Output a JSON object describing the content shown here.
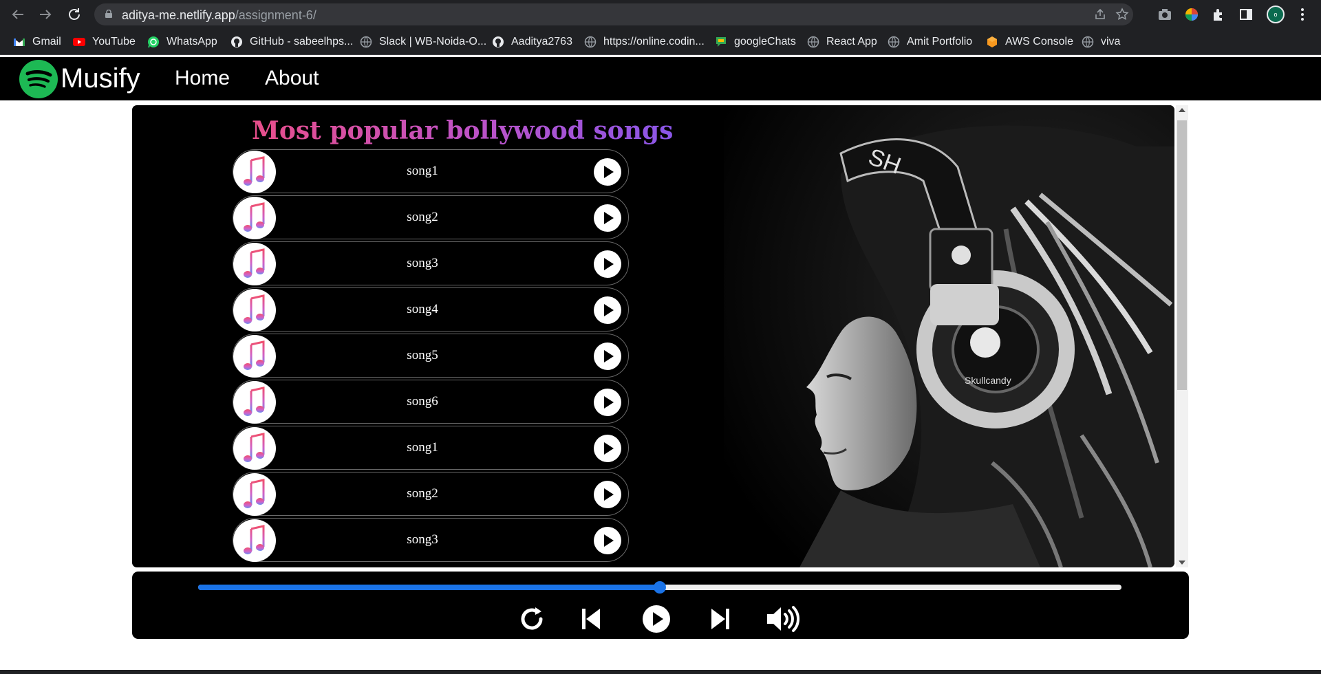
{
  "browser": {
    "url_host": "aditya-me.netlify.app",
    "url_path": "/assignment-6/",
    "profile_initial": "o",
    "bookmarks": [
      {
        "label": "Gmail",
        "icon": "gmail-icon",
        "color": "#ea4335"
      },
      {
        "label": "YouTube",
        "icon": "youtube-icon",
        "color": "#ff0000"
      },
      {
        "label": "WhatsApp",
        "icon": "whatsapp-icon",
        "color": "#25d366"
      },
      {
        "label": "GitHub - sabeelhps...",
        "icon": "github-icon",
        "color": "#e8eaed"
      },
      {
        "label": "Slack | WB-Noida-O...",
        "icon": "globe-icon",
        "color": "#9aa0a6"
      },
      {
        "label": "Aaditya2763",
        "icon": "github-icon",
        "color": "#e8eaed"
      },
      {
        "label": "https://online.codin...",
        "icon": "globe-icon",
        "color": "#9aa0a6"
      },
      {
        "label": "googleChats",
        "icon": "google-chat-icon",
        "color": "#34a853"
      },
      {
        "label": "React App",
        "icon": "globe-icon",
        "color": "#9aa0a6"
      },
      {
        "label": "Amit Portfolio",
        "icon": "globe-icon",
        "color": "#9aa0a6"
      },
      {
        "label": "AWS Console",
        "icon": "aws-icon",
        "color": "#f90"
      },
      {
        "label": "viva",
        "icon": "globe-icon",
        "color": "#9aa0a6"
      }
    ]
  },
  "site": {
    "brand": "Musify",
    "nav": [
      "Home",
      "About"
    ],
    "accent": "#1db954"
  },
  "playlist": {
    "heading": "Most popular bollywood songs",
    "songs": [
      "song1",
      "song2",
      "song3",
      "song4",
      "song5",
      "song6",
      "song1",
      "song2",
      "song3"
    ]
  },
  "player": {
    "progress_fraction": 0.5,
    "controls": [
      "replay-icon",
      "previous-icon",
      "play-icon",
      "next-icon",
      "volume-icon"
    ],
    "progress_color": "#1a73e8"
  }
}
